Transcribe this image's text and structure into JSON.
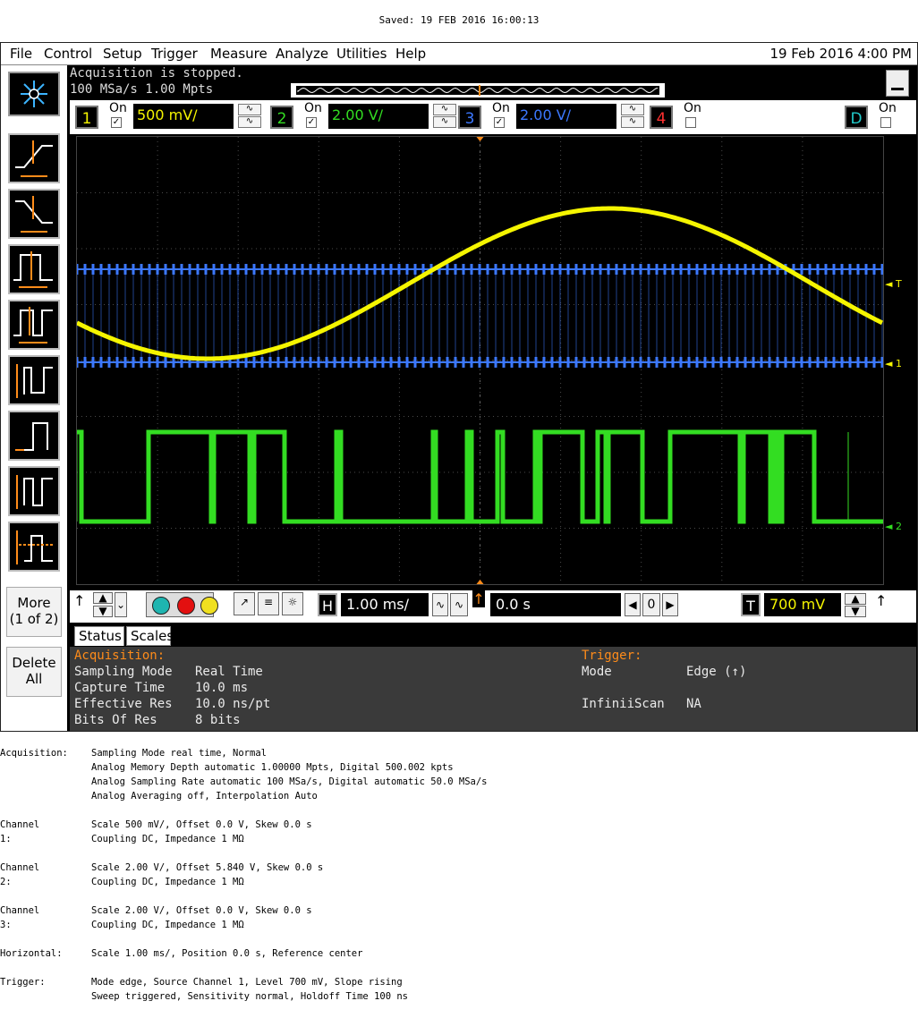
{
  "saved_line": "Saved:  19 FEB 2016  16:00:13",
  "menu": [
    "File",
    "Control",
    "Setup",
    "Trigger",
    "Measure",
    "Analyze",
    "Utilities",
    "Help"
  ],
  "datetime": "19 Feb 2016   4:00 PM",
  "acquisition_status": {
    "line1": "Acquisition is stopped.",
    "line2": "100 MSa/s    1.00 Mpts"
  },
  "left_buttons": {
    "more_label": "More",
    "more_sub": "(1 of 2)",
    "delete_label": "Delete",
    "delete_sub": "All"
  },
  "channels": [
    {
      "num": "1",
      "on_label": "On",
      "checked": true,
      "scale": "500 mV/",
      "color": "#f5f500"
    },
    {
      "num": "2",
      "on_label": "On",
      "checked": true,
      "scale": "2.00 V/",
      "color": "#33dd22"
    },
    {
      "num": "3",
      "on_label": "On",
      "checked": true,
      "scale": "2.00 V/",
      "color": "#3c78ff"
    },
    {
      "num": "4",
      "on_label": "On",
      "checked": false,
      "scale": "",
      "color": "#ff3030"
    },
    {
      "num": "D",
      "on_label": "On",
      "checked": false,
      "scale": "",
      "color": "#22cccc"
    }
  ],
  "waveform_markers": {
    "trigger": "T",
    "ch1": "1",
    "ch2": "2"
  },
  "horizontal": {
    "h_label": "H",
    "scale": "1.00 ms/",
    "position": "0.0 s",
    "ref_value": "0"
  },
  "trigger_ctrl": {
    "t_label": "T",
    "level": "700 mV"
  },
  "tabs": [
    "Status",
    "Scales"
  ],
  "status": {
    "acq_header": "Acquisition:",
    "rows": [
      {
        "label": "Sampling Mode",
        "value": "Real Time"
      },
      {
        "label": "Capture Time",
        "value": "10.0 ms"
      },
      {
        "label": "Effective Res",
        "value": "10.0 ns/pt"
      },
      {
        "label": "Bits Of Res",
        "value": "8 bits"
      }
    ],
    "trig_header": "Trigger:",
    "trig_rows": [
      {
        "label": "Mode",
        "value": "Edge (↑)"
      },
      {
        "label": "InfiniiScan",
        "value": "NA"
      }
    ]
  },
  "notes": [
    {
      "label": "Acquisition:",
      "lines": [
        "Sampling Mode real time, Normal",
        "Analog Memory Depth automatic 1.00000 Mpts, Digital 500.002 kpts",
        "Analog Sampling Rate automatic 100 MSa/s, Digital automatic 50.0 MSa/s",
        "Analog Averaging off, Interpolation Auto"
      ]
    },
    {
      "label": "Channel 1:",
      "lines": [
        "Scale 500 mV/, Offset 0.0 V, Skew 0.0 s",
        "Coupling DC, Impedance 1 MΩ"
      ]
    },
    {
      "label": "Channel 2:",
      "lines": [
        "Scale 2.00 V/, Offset 5.840 V, Skew 0.0 s",
        "Coupling DC, Impedance 1 MΩ"
      ]
    },
    {
      "label": "Channel 3:",
      "lines": [
        "Scale 2.00 V/, Offset 0.0 V, Skew 0.0 s",
        "Coupling DC, Impedance 1 MΩ"
      ]
    },
    {
      "label": "Horizontal:",
      "lines": [
        "Scale 1.00 ms/, Position 0.0 s, Reference center"
      ]
    },
    {
      "label": "Trigger:",
      "lines": [
        "Mode edge, Source Channel 1, Level 700 mV, Slope rising",
        "Sweep triggered, Sensitivity normal, Holdoff Time 100 ns"
      ]
    }
  ],
  "colors": {
    "ch1": "#f5f500",
    "ch2": "#33dd22",
    "ch3": "#3c78ff",
    "accent": "#ff8c1a",
    "grid": "#4a4a4a"
  }
}
